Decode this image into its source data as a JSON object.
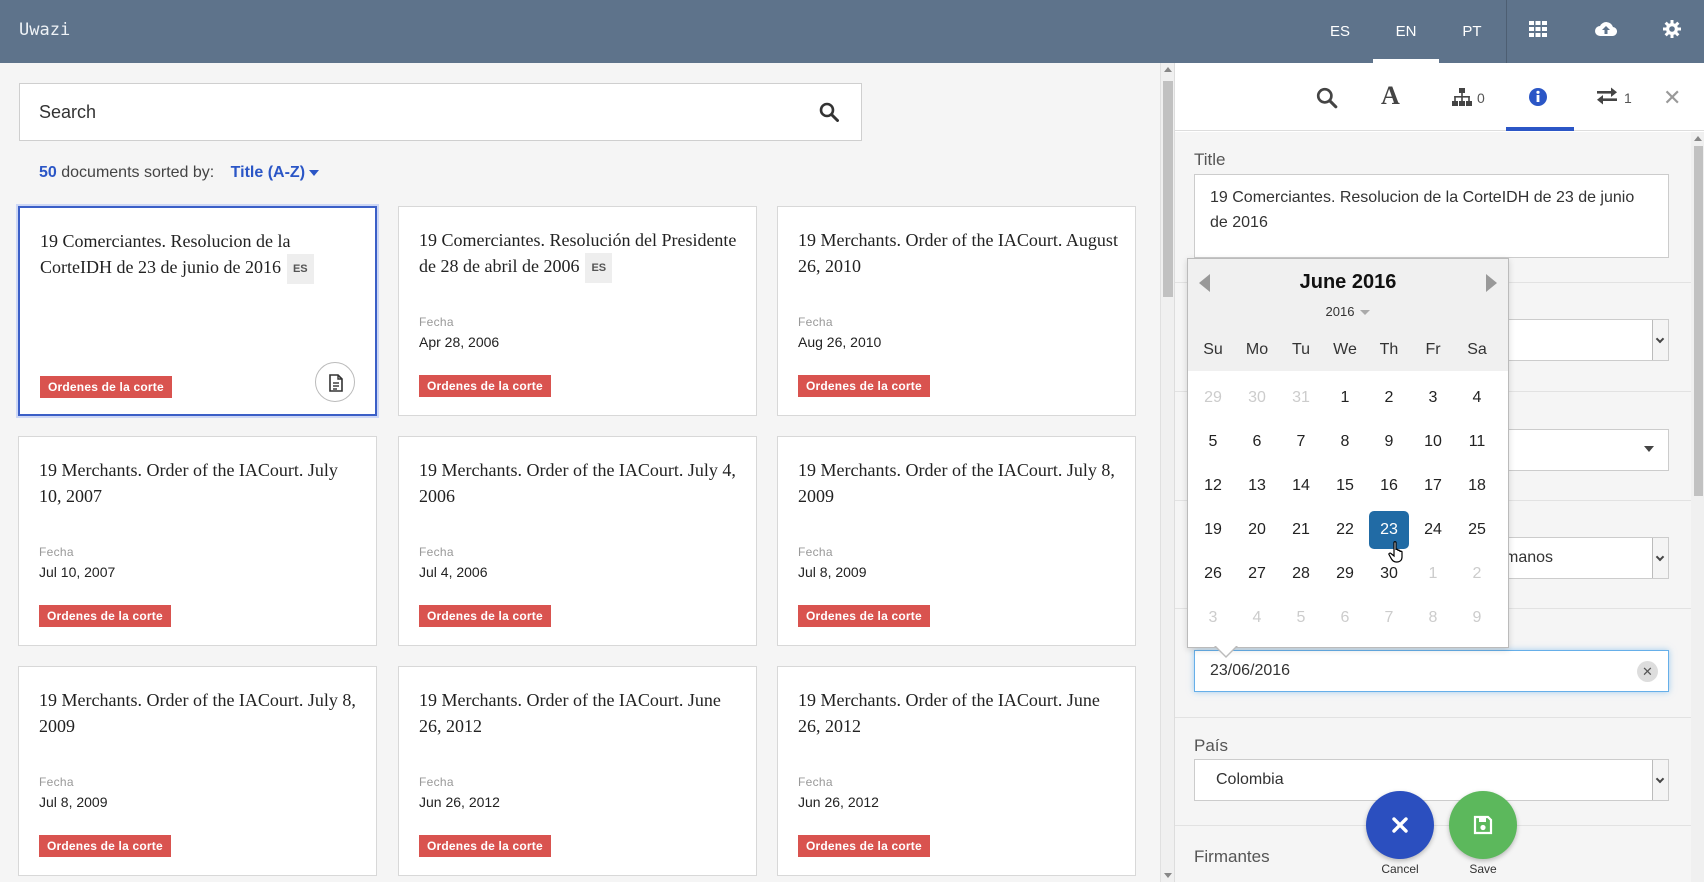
{
  "app": {
    "title": "Uwazi"
  },
  "languages": [
    {
      "code": "ES",
      "active": false
    },
    {
      "code": "EN",
      "active": true
    },
    {
      "code": "PT",
      "active": false
    }
  ],
  "nav_icons": [
    "grid-icon",
    "cloud-upload-icon",
    "gear-icon"
  ],
  "search": {
    "placeholder": "Search"
  },
  "sort": {
    "count": "50",
    "text": "documents sorted by:",
    "value": "Title (A-Z)"
  },
  "documents": [
    {
      "title": "19 Comerciantes. Resolucion de la CorteIDH de 23 de junio de 2016",
      "lang": "ES",
      "meta_label": "",
      "meta_value": "",
      "tag": "Ordenes de la corte",
      "selected": true
    },
    {
      "title": "19 Comerciantes. Resolución del Presidente de 28 de abril de 2006",
      "lang": "ES",
      "meta_label": "Fecha",
      "meta_value": "Apr 28, 2006",
      "tag": "Ordenes de la corte",
      "selected": false
    },
    {
      "title": "19 Merchants. Order of the IACourt. August 26, 2010",
      "lang": "",
      "meta_label": "Fecha",
      "meta_value": "Aug 26, 2010",
      "tag": "Ordenes de la corte",
      "selected": false
    },
    {
      "title": "19 Merchants. Order of the IACourt. July 10, 2007",
      "lang": "",
      "meta_label": "Fecha",
      "meta_value": "Jul 10, 2007",
      "tag": "Ordenes de la corte",
      "selected": false
    },
    {
      "title": "19 Merchants. Order of the IACourt. July 4, 2006",
      "lang": "",
      "meta_label": "Fecha",
      "meta_value": "Jul 4, 2006",
      "tag": "Ordenes de la corte",
      "selected": false
    },
    {
      "title": "19 Merchants. Order of the IACourt. July 8, 2009",
      "lang": "",
      "meta_label": "Fecha",
      "meta_value": "Jul 8, 2009",
      "tag": "Ordenes de la corte",
      "selected": false
    },
    {
      "title": "19 Merchants. Order of the IACourt. July 8, 2009",
      "lang": "",
      "meta_label": "Fecha",
      "meta_value": "Jul 8, 2009",
      "tag": "Ordenes de la corte",
      "selected": false
    },
    {
      "title": "19 Merchants. Order of the IACourt. June 26, 2012",
      "lang": "",
      "meta_label": "Fecha",
      "meta_value": "Jun 26, 2012",
      "tag": "Ordenes de la corte",
      "selected": false
    },
    {
      "title": "19 Merchants. Order of the IACourt. June 26, 2012",
      "lang": "",
      "meta_label": "Fecha",
      "meta_value": "Jun 26, 2012",
      "tag": "Ordenes de la corte",
      "selected": false
    }
  ],
  "panel": {
    "tabs": [
      {
        "icon": "search-icon",
        "count": ""
      },
      {
        "icon": "font-icon",
        "count": ""
      },
      {
        "icon": "sitemap-icon",
        "count": "0"
      },
      {
        "icon": "info-icon",
        "count": "",
        "active": true
      },
      {
        "icon": "exchange-icon",
        "count": "1"
      }
    ],
    "title_label": "Title",
    "title_value": "19 Comerciantes. Resolucion de la CorteIDH de 23 de junio de 2016",
    "partial_select_text": "manos",
    "date_value": "23/06/2016",
    "pais_label": "País",
    "pais_value": "Colombia",
    "firmantes_label": "Firmantes"
  },
  "datepicker": {
    "month": "June 2016",
    "year": "2016",
    "weekdays": [
      "Su",
      "Mo",
      "Tu",
      "We",
      "Th",
      "Fr",
      "Sa"
    ],
    "weeks": [
      [
        "29",
        "30",
        "31",
        "1",
        "2",
        "3",
        "4"
      ],
      [
        "5",
        "6",
        "7",
        "8",
        "9",
        "10",
        "11"
      ],
      [
        "12",
        "13",
        "14",
        "15",
        "16",
        "17",
        "18"
      ],
      [
        "19",
        "20",
        "21",
        "22",
        "23",
        "24",
        "25"
      ],
      [
        "26",
        "27",
        "28",
        "29",
        "30",
        "1",
        "2"
      ],
      [
        "3",
        "4",
        "5",
        "6",
        "7",
        "8",
        "9"
      ]
    ],
    "selected": "23"
  },
  "actions": {
    "cancel_label": "Cancel",
    "save_label": "Save"
  },
  "colors": {
    "topbar": "#5e738b",
    "accent": "#2b56c6",
    "tag": "#d9534f",
    "cancel": "#2b4fbf",
    "save": "#5cb85c",
    "selected_day": "#216ba5"
  }
}
